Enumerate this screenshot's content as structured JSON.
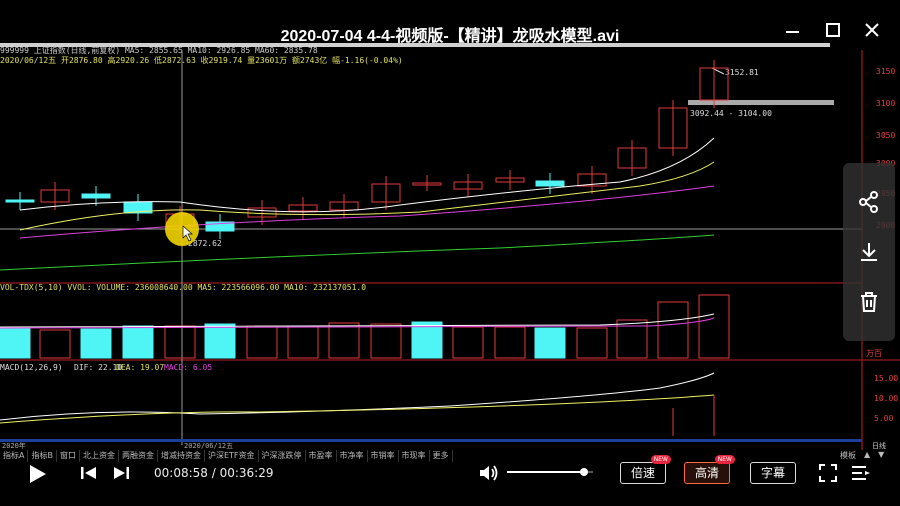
{
  "window": {
    "title": "2020-07-04 4-4-视频版-【精讲】龙吸水模型.avi"
  },
  "chart_header": {
    "code_line": "999999 上证指数(日线,前复权) MA5: 2855.65 MA10: 2926.85 MA60: 2835.78",
    "info_line": "2020/06/12五 开2876.80 高2920.26 低2872.63 收2919.74 量23601万 额2743亿 幅-1.16(-0.04%)",
    "price_ticks": [
      "3150",
      "3100",
      "3050",
      "3000",
      "2950",
      "2900"
    ],
    "high_label": "3152.81",
    "low_label": "2872.62",
    "range_label": "3092.44 - 3104.00"
  },
  "volume_header": "VOL-TDX(5,10) VVOL: VOLUME: 236008640.00 MA5: 223566096.00 MA10: 232137051.0",
  "volume_unit": "万百",
  "macd_header": {
    "name": "MACD(12,26,9)",
    "dif": "DIF: 22.10",
    "dea": "DEA: 19.07",
    "macd": "MACD: 6.05"
  },
  "macd_ticks": [
    "15.00",
    "10.00",
    "5.00"
  ],
  "date_labels": {
    "left": "2020年",
    "cursor": "2020/06/12五",
    "right": "日线"
  },
  "bottom_tabs": [
    "指标A",
    "指标B",
    "窗口",
    "北上资金",
    "两融资金",
    "增减持资金",
    "沪深ETF资金",
    "沪深涨跌停",
    "市盈率",
    "市净率",
    "市销率",
    "市现率",
    "更多"
  ],
  "bottom_tabs_right": [
    "模板",
    "▲",
    "▼"
  ],
  "player": {
    "current_time": "00:08:58",
    "separator": " / ",
    "duration": "00:36:29",
    "speed_label": "倍速",
    "quality_label": "高清",
    "subtitle_label": "字幕",
    "new_badge": "NEW",
    "volume_level": 0.9
  },
  "colors": {
    "up": "#e23a3a",
    "down": "#4ff5f5",
    "ma5": "#ffffff",
    "ma10": "#f0f060",
    "ma20": "#e040e0",
    "ma60": "#30d030",
    "accent": "#ff6a3d"
  }
}
